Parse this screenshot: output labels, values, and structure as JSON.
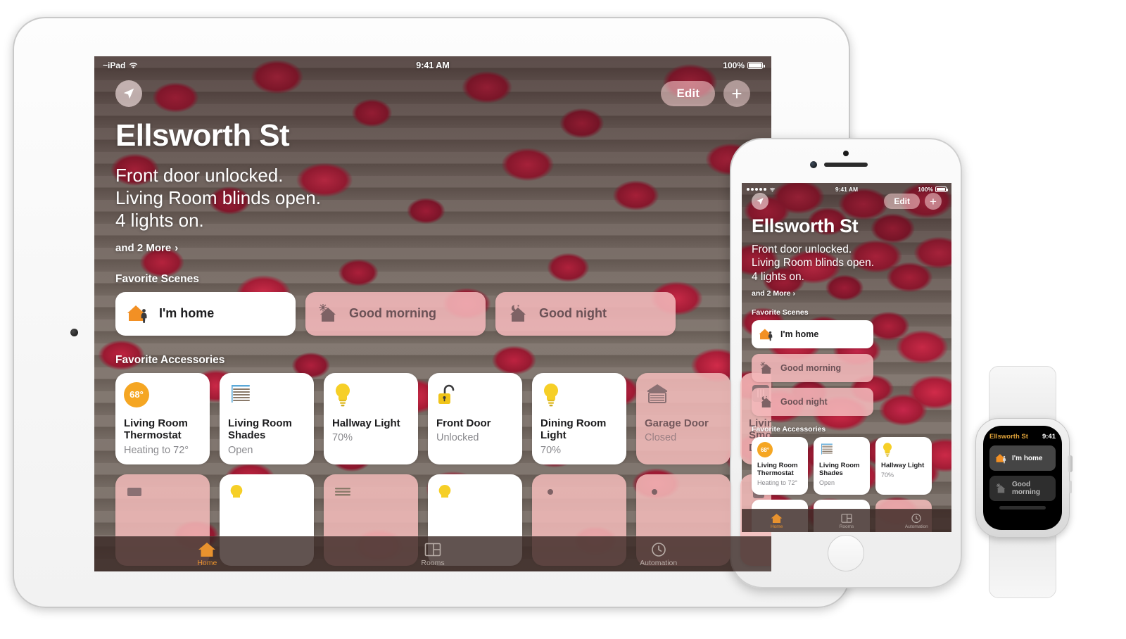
{
  "home": {
    "title": "Ellsworth St",
    "status_lines": [
      "Front door unlocked.",
      "Living Room blinds open.",
      "4 lights on."
    ],
    "more_link": "and 2 More",
    "chevron": "›",
    "edit_label": "Edit",
    "plus_label": "+",
    "location_icon": "location-arrow-icon"
  },
  "statusbar": {
    "ipad_carrier": "~iPad",
    "wifi_icon": "wifi-icon",
    "time": "9:41 AM",
    "battery_percent": "100%"
  },
  "sections": {
    "scenes_title": "Favorite Scenes",
    "accessories_title": "Favorite Accessories"
  },
  "scenes": [
    {
      "label": "I'm home",
      "state": "on",
      "icon": "house-person-icon"
    },
    {
      "label": "Good morning",
      "state": "off",
      "icon": "house-sun-icon"
    },
    {
      "label": "Good night",
      "state": "off",
      "icon": "house-moon-icon"
    }
  ],
  "accessories": [
    {
      "name": "Living Room Thermostat",
      "state": "Heating to 72°",
      "power": "on",
      "icon": "thermostat-icon",
      "badge": "68°",
      "alert": false
    },
    {
      "name": "Living Room Shades",
      "state": "Open",
      "power": "on",
      "icon": "blinds-icon",
      "badge": "",
      "alert": false
    },
    {
      "name": "Hallway Light",
      "state": "70%",
      "power": "on",
      "icon": "lightbulb-icon",
      "badge": "",
      "alert": false
    },
    {
      "name": "Front Door",
      "state": "Unlocked",
      "power": "on",
      "icon": "unlocked-lock-icon",
      "badge": "",
      "alert": true
    },
    {
      "name": "Dining Room Light",
      "state": "70%",
      "power": "on",
      "icon": "lightbulb-icon",
      "badge": "",
      "alert": false
    },
    {
      "name": "Garage Door",
      "state": "Closed",
      "power": "off",
      "icon": "garage-door-icon",
      "badge": "",
      "alert": false
    },
    {
      "name": "Living Room Smoke Detector",
      "state": "",
      "power": "off",
      "icon": "smoke-detector-icon",
      "badge": "",
      "alert": false
    }
  ],
  "iphone_accessories": [
    {
      "name": "Living Room Thermostat",
      "state": "Heating to 72°",
      "power": "on",
      "icon": "thermostat-icon",
      "badge": "68°"
    },
    {
      "name": "Living Room Shades",
      "state": "Open",
      "power": "on",
      "icon": "blinds-icon",
      "badge": ""
    },
    {
      "name": "Hallway Light",
      "state": "70%",
      "power": "on",
      "icon": "lightbulb-icon",
      "badge": ""
    }
  ],
  "tabs": [
    {
      "label": "Home",
      "icon": "house-icon",
      "active": true
    },
    {
      "label": "Rooms",
      "icon": "rooms-icon",
      "active": false
    },
    {
      "label": "Automation",
      "icon": "clock-icon",
      "active": false
    }
  ],
  "iphone_statusbar": {
    "signal_icon": "signal-dots-icon",
    "wifi_icon": "wifi-icon",
    "time": "9:41 AM",
    "battery_percent": "100%"
  },
  "watch": {
    "title": "Ellsworth St",
    "time": "9:41",
    "scenes": [
      {
        "label": "I'm home",
        "state": "on",
        "icon": "house-person-icon"
      },
      {
        "label": "Good morning",
        "state": "off",
        "icon": "house-sun-icon"
      }
    ]
  },
  "colors": {
    "accent_orange": "#e8922e",
    "alert_red": "#e8453c",
    "pink_tile": "#f3bbba",
    "watch_title": "#e0a33a",
    "thermostat_badge": "#f5a623",
    "bulb_yellow": "#f6cf27"
  }
}
